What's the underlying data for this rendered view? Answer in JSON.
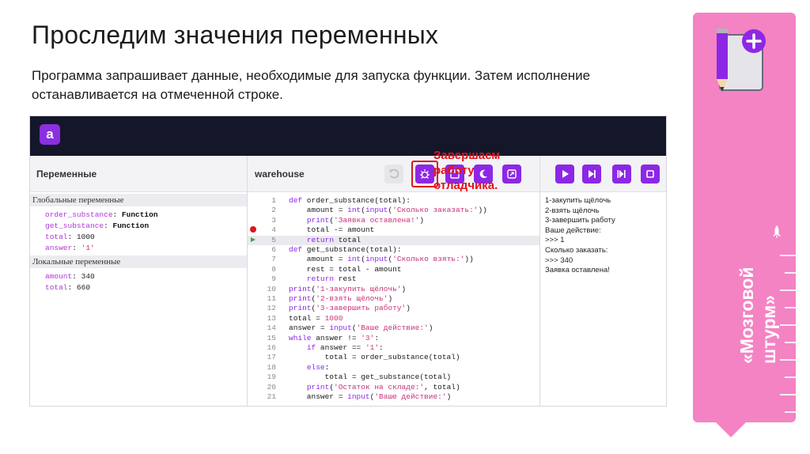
{
  "slide": {
    "title": "Проследим значения переменных",
    "subtitle": "Программа запрашивает данные, необходимые для запуска функции. Затем исполнение останавливается на отмеченной строке."
  },
  "app": {
    "logo": "a",
    "variables_panel": {
      "title": "Переменные",
      "global_header": "Глобальные переменные",
      "global_vars": [
        {
          "name": "order_substance",
          "value": "Function",
          "kind": "function"
        },
        {
          "name": "get_substance",
          "value": "Function",
          "kind": "function"
        },
        {
          "name": "total",
          "value": "1000",
          "kind": "int"
        },
        {
          "name": "answer",
          "value": "'1'",
          "kind": "str"
        }
      ],
      "local_header": "Локальные переменные",
      "local_vars": [
        {
          "name": "amount",
          "value": "340",
          "kind": "int"
        },
        {
          "name": "total",
          "value": "660",
          "kind": "int"
        }
      ]
    },
    "code_panel": {
      "title": "warehouse",
      "breakpoint_line": 4,
      "current_line": 5,
      "lines": [
        {
          "n": "1",
          "code": "def order_substance(total):"
        },
        {
          "n": "2",
          "code": "    amount = int(input('Сколько заказать:'))"
        },
        {
          "n": "3",
          "code": "    print('Заявка оставлена!')"
        },
        {
          "n": "4",
          "code": "    total -= amount"
        },
        {
          "n": "5",
          "code": "    return total"
        },
        {
          "n": "6",
          "code": "def get_substance(total):"
        },
        {
          "n": "7",
          "code": "    amount = int(input('Сколько взять:'))"
        },
        {
          "n": "8",
          "code": "    rest = total - amount"
        },
        {
          "n": "9",
          "code": "    return rest"
        },
        {
          "n": "10",
          "code": "print('1-закупить щёлочь')"
        },
        {
          "n": "11",
          "code": "print('2-взять щёлочь')"
        },
        {
          "n": "12",
          "code": "print('3-завершить работу')"
        },
        {
          "n": "13",
          "code": "total = 1000"
        },
        {
          "n": "14",
          "code": "answer = input('Ваше действие:')"
        },
        {
          "n": "15",
          "code": "while answer != '3':"
        },
        {
          "n": "16",
          "code": "    if answer == '1':"
        },
        {
          "n": "17",
          "code": "        total = order_substance(total)"
        },
        {
          "n": "18",
          "code": "    else:"
        },
        {
          "n": "19",
          "code": "        total = get_substance(total)"
        },
        {
          "n": "20",
          "code": "    print('Остаток на складе:', total)"
        },
        {
          "n": "21",
          "code": "    answer = input('Ваше действие:')"
        }
      ]
    },
    "annotation": "Завершаем работу отладчика.",
    "console": {
      "lines": [
        "1-закупить щёлочь",
        "2-взять щёлочь",
        "3-завершить работу",
        "Ваше действие:",
        ">>> 1",
        "Сколько заказать:",
        ">>> 340",
        "Заявка оставлена!"
      ]
    },
    "colors": {
      "accent": "#8d27e6",
      "topbar": "#14172a",
      "highlight": "#e0141c",
      "breakpoint": "#e0141c",
      "current_arrow": "#2fa84f"
    }
  },
  "sidebar": {
    "label": "«Мозговой штурм»",
    "color": "#f483c4",
    "icons": [
      "notebook-pencil-plus-icon",
      "rocket-icon"
    ]
  }
}
